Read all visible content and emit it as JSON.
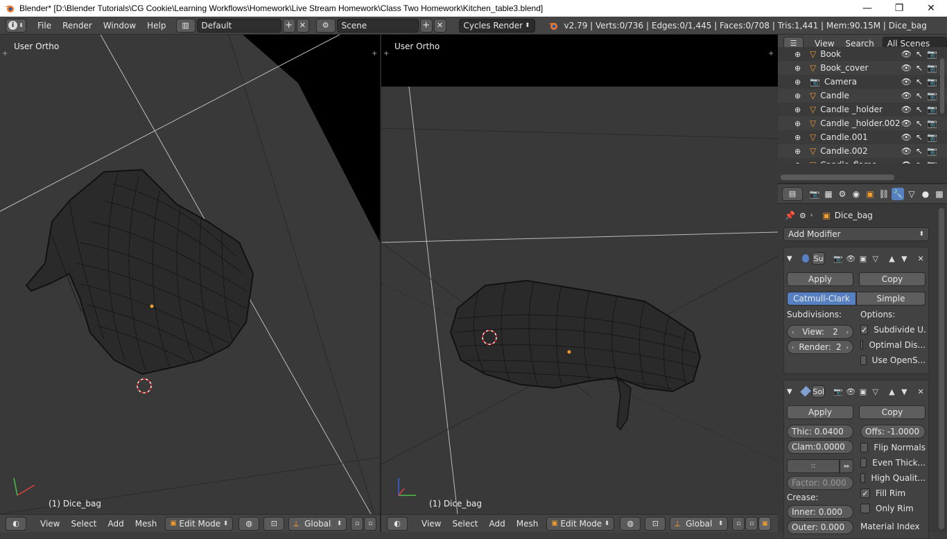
{
  "window": {
    "title": "Blender* [D:\\Blender Tutorials\\CG Cookie\\Learning Workflows\\Homework\\Live Stream Homework\\Class Two Homework\\Kitchen_table3.blend]",
    "minimize": "—",
    "maximize": "❐",
    "close": "✕"
  },
  "topbar": {
    "info_icon": "i",
    "menus": [
      "File",
      "Render",
      "Window",
      "Help"
    ],
    "layout_name": "Default",
    "scene_name": "Scene",
    "render_engine": "Cycles Render",
    "stats": "v2.79 | Verts:0/736 | Edges:0/1,445 | Faces:0/708 | Tris:1,441 | Mem:90.15M | Dice_bag"
  },
  "viewports": [
    {
      "label": "User Ortho",
      "object_label": "(1) Dice_bag"
    },
    {
      "label": "User Ortho",
      "object_label": "(1) Dice_bag"
    }
  ],
  "bottombar": {
    "menus": [
      "View",
      "Select",
      "Add",
      "Mesh"
    ],
    "mode": "Edit Mode",
    "orientation": "Global"
  },
  "outliner": {
    "view": "View",
    "search": "Search",
    "filter": "All Scenes",
    "items": [
      {
        "name": "Book",
        "type": "mesh"
      },
      {
        "name": "Book_cover",
        "type": "mesh"
      },
      {
        "name": "Camera",
        "type": "camera"
      },
      {
        "name": "Candle",
        "type": "mesh"
      },
      {
        "name": "Candle _holder",
        "type": "mesh"
      },
      {
        "name": "Candle _holder.002",
        "type": "mesh"
      },
      {
        "name": "Candle.001",
        "type": "mesh"
      },
      {
        "name": "Candle.002",
        "type": "mesh"
      },
      {
        "name": "Candle_flame",
        "type": "mesh"
      }
    ]
  },
  "properties": {
    "object_name": "Dice_bag",
    "add_modifier": "Add Modifier",
    "subsurf": {
      "name": "Su",
      "apply": "Apply",
      "copy": "Copy",
      "mode_active": "Catmull-Clark",
      "mode_other": "Simple",
      "subdivisions_label": "Subdivisions:",
      "options_label": "Options:",
      "view_label": "View:",
      "view_value": "2",
      "render_label": "Render:",
      "render_value": "2",
      "options": [
        {
          "label": "Subdivide U...",
          "checked": true
        },
        {
          "label": "Optimal Dis...",
          "checked": false
        },
        {
          "label": "Use OpenS...",
          "checked": false
        }
      ]
    },
    "solidify": {
      "name": "Sol",
      "apply": "Apply",
      "copy": "Copy",
      "thickness": "Thic: 0.0400",
      "offset": "Offs: -1.0000",
      "clamp": "Clam:0.0000",
      "factor": "Factor: 0.000",
      "crease_label": "Crease:",
      "inner": "Inner:  0.000",
      "outer": "Outer:  0.000",
      "material_index": "Material Index",
      "options": [
        {
          "label": "Flip Normals",
          "checked": false
        },
        {
          "label": "Even Thick...",
          "checked": false
        },
        {
          "label": "High Qualit...",
          "checked": false
        },
        {
          "label": "Fill Rim",
          "checked": true
        },
        {
          "label": "Only Rim",
          "checked": false
        }
      ]
    }
  },
  "colors": {
    "accent_blue": "#5680c2",
    "mesh_orange": "#f29d2e",
    "background": "#393939"
  }
}
